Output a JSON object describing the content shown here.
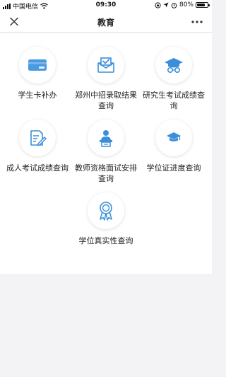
{
  "status_bar": {
    "carrier": "中国电信",
    "time": "09:30",
    "battery": "80%",
    "battery_level": 0.8
  },
  "nav": {
    "title": "教育"
  },
  "services": [
    {
      "label": "学生卡补办",
      "icon": "student-card-icon"
    },
    {
      "label": "郑州中招录取结果查询",
      "icon": "envelope-check-icon"
    },
    {
      "label": "研究生考试成绩查询",
      "icon": "graduation-cap-glasses-icon"
    },
    {
      "label": "成人考试成绩查询",
      "icon": "document-pen-icon"
    },
    {
      "label": "教师资格面试安排查询",
      "icon": "teacher-podium-icon"
    },
    {
      "label": "学位证进度查询",
      "icon": "graduation-cap-icon"
    },
    {
      "label": "学位真实性查询",
      "icon": "award-ribbon-icon"
    }
  ],
  "colors": {
    "accent": "#3b8fd8",
    "background": "#f3f3f5"
  }
}
